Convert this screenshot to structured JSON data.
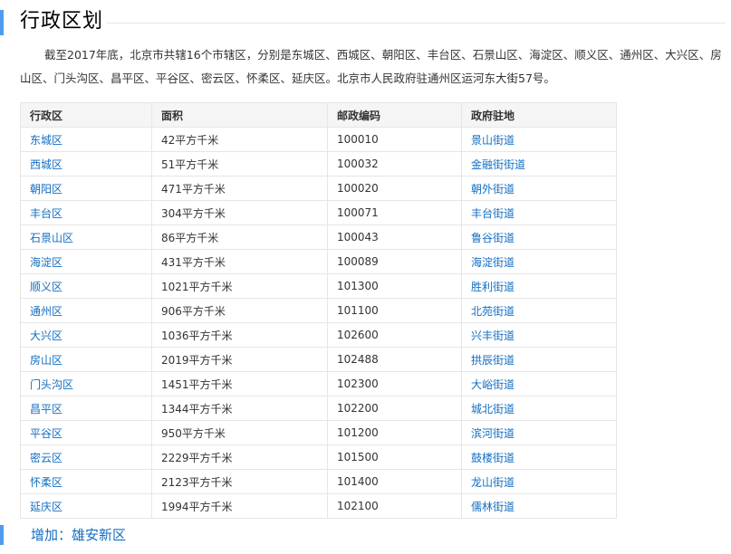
{
  "colors": {
    "accent_bar": "#4f9cee",
    "link": "#136ec2",
    "header_bg": "#f5f5f5",
    "border": "#e6e6e6"
  },
  "section": {
    "title": "行政区划"
  },
  "intro": {
    "text": "截至2017年底，北京市共辖16个市辖区，分别是东城区、西城区、朝阳区、丰台区、石景山区、海淀区、顺义区、通州区、大兴区、房山区、门头沟区、昌平区、平谷区、密云区、怀柔区、延庆区。北京市人民政府驻通州区运河东大街57号。"
  },
  "table": {
    "headers": [
      "行政区",
      "面积",
      "邮政编码",
      "政府驻地"
    ],
    "rows": [
      {
        "district": "东城区",
        "area": "42平方千米",
        "postcode": "100010",
        "seat": "景山街道"
      },
      {
        "district": "西城区",
        "area": "51平方千米",
        "postcode": "100032",
        "seat": "金融街街道"
      },
      {
        "district": "朝阳区",
        "area": "471平方千米",
        "postcode": "100020",
        "seat": "朝外街道"
      },
      {
        "district": "丰台区",
        "area": "304平方千米",
        "postcode": "100071",
        "seat": "丰台街道"
      },
      {
        "district": "石景山区",
        "area": "86平方千米",
        "postcode": "100043",
        "seat": "鲁谷街道"
      },
      {
        "district": "海淀区",
        "area": "431平方千米",
        "postcode": "100089",
        "seat": "海淀街道"
      },
      {
        "district": "顺义区",
        "area": "1021平方千米",
        "postcode": "101300",
        "seat": "胜利街道"
      },
      {
        "district": "通州区",
        "area": "906平方千米",
        "postcode": "101100",
        "seat": "北苑街道"
      },
      {
        "district": "大兴区",
        "area": "1036平方千米",
        "postcode": "102600",
        "seat": "兴丰街道"
      },
      {
        "district": "房山区",
        "area": "2019平方千米",
        "postcode": "102488",
        "seat": "拱辰街道"
      },
      {
        "district": "门头沟区",
        "area": "1451平方千米",
        "postcode": "102300",
        "seat": "大峪街道"
      },
      {
        "district": "昌平区",
        "area": "1344平方千米",
        "postcode": "102200",
        "seat": "城北街道"
      },
      {
        "district": "平谷区",
        "area": "950平方千米",
        "postcode": "101200",
        "seat": "滨河街道"
      },
      {
        "district": "密云区",
        "area": "2229平方千米",
        "postcode": "101500",
        "seat": "鼓楼街道"
      },
      {
        "district": "怀柔区",
        "area": "2123平方千米",
        "postcode": "101400",
        "seat": "龙山街道"
      },
      {
        "district": "延庆区",
        "area": "1994平方千米",
        "postcode": "102100",
        "seat": "儒林街道"
      }
    ]
  },
  "addition": {
    "label": "增加：",
    "link": "雄安新区"
  }
}
